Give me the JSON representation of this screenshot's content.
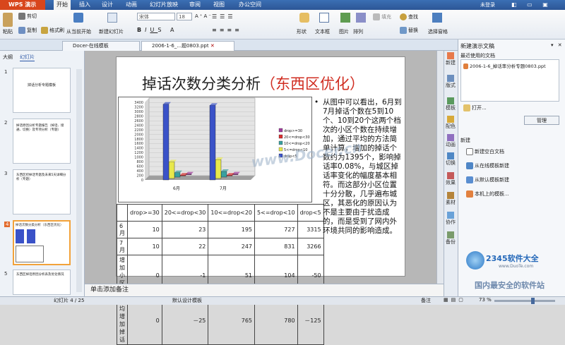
{
  "app": {
    "name": "WPS 演示"
  },
  "menus": [
    "开始",
    "插入",
    "设计",
    "动画",
    "幻灯片放映",
    "审阅",
    "视图",
    "办公空间"
  ],
  "login": "未登录",
  "ribbon": {
    "paste": "粘贴",
    "cut": "剪切",
    "copy": "复制",
    "format_painter": "格式刷",
    "from_current": "从当前开始",
    "new_slide": "新建幻灯片",
    "font": "宋体",
    "font_size": "18",
    "shape": "形状",
    "textbox": "文本框",
    "picture": "图片",
    "arrange": "排列",
    "fill": "填充",
    "find": "查找",
    "replace": "替换",
    "select_pane": "选择窗格"
  },
  "tabs": {
    "docer": "Docer-在线模板",
    "file": "2006-1-6_...题0803.ppt"
  },
  "left_tabs": {
    "outline": "大纲",
    "slides": "幻灯片"
  },
  "thumbnails": [
    {
      "num": "1",
      "text": "掉话分析专题模板"
    },
    {
      "num": "2",
      "text": "掉话原因分析专题报告（掉话、接通、切换）及专项分析（专题）"
    },
    {
      "num": "3",
      "text": "东西区控掉话专题及未来5天详细分析（专题）"
    },
    {
      "num": "4",
      "text": "掉话次数分类分析（东西区优化）"
    },
    {
      "num": "5",
      "text": "东西区掉话原因分析表及优化情况"
    }
  ],
  "slide": {
    "title": "掉话次数分类分析",
    "title_accent": "（东西区优化）",
    "bullet": "从图中可以看出，6月到7月掉话个数在5到10个、10到20个这两个档次的小区个数在持续增加，通过平均的方法简单计算，增加的掉话个数约为1395个，影响掉话率0.08%，与城区掉话率变化的幅度基本相符。而这部分小区位置十分分散，几乎遍布城区，其恶化的原因认为不是主要由于扰造成的，而是受到了网内外环境共同的影响造成。",
    "table": {
      "headers": [
        "",
        "drop>=30",
        "20<=drop<30",
        "10<=drop<20",
        "5<=drop<10",
        "drop<5"
      ],
      "rows": [
        [
          "6月",
          "10",
          "23",
          "195",
          "727",
          "3315"
        ],
        [
          "7月",
          "10",
          "22",
          "247",
          "831",
          "3266"
        ],
        [
          "增加小区数",
          "0",
          "-1",
          "51",
          "104",
          "-50"
        ],
        [
          "平均增加掉话",
          "0",
          "－25",
          "765",
          "780",
          "－125"
        ]
      ]
    },
    "watermark": "www.Docer.cn"
  },
  "chart_data": {
    "type": "bar",
    "title": "",
    "categories": [
      "6月",
      "7月"
    ],
    "y_ticks": [
      "3400",
      "3200",
      "3000",
      "2800",
      "2600",
      "2400",
      "2200",
      "2000",
      "1800",
      "1600",
      "1400",
      "1200",
      "1000",
      "800",
      "600",
      "400",
      "200",
      "0"
    ],
    "series": [
      {
        "name": "drop>=30",
        "color": "#a03c9c",
        "values": [
          10,
          10
        ]
      },
      {
        "name": "20<=drop<30",
        "color": "#d63030",
        "values": [
          23,
          22
        ]
      },
      {
        "name": "10<=drop<20",
        "color": "#39a0a0",
        "values": [
          195,
          247
        ]
      },
      {
        "name": "5<=drop<10",
        "color": "#e8e84c",
        "values": [
          727,
          831
        ]
      },
      {
        "name": "drop<5",
        "color": "#3a52c8",
        "values": [
          3315,
          3266
        ]
      }
    ],
    "ylim": [
      0,
      3400
    ]
  },
  "sidebar": [
    "新建",
    "版式",
    "模板",
    "配色",
    "动画",
    "切换",
    "效果",
    "素材",
    "协作",
    "备份"
  ],
  "rightpane": {
    "title": "新建演示文稿",
    "recent_title": "最近使用的文档",
    "recent_file": "2006-1-6_掉话率分析专题0803.ppt",
    "open": "打开...",
    "manage": "管理",
    "new_title": "新建",
    "items": [
      "新建空白文档",
      "从在线模板新建",
      "从默认模板新建",
      "本机上的模板..."
    ]
  },
  "notes": "单击添加备注",
  "status": {
    "slide_info": "幻灯片 4 / 25",
    "template": "默认设计模板",
    "notes_btn": "备注",
    "zoom": "73 %"
  },
  "watermark_site": {
    "brand": "2345软件大全",
    "url": "www.DuoTe.com",
    "slogan": "国内最安全的软件站"
  }
}
